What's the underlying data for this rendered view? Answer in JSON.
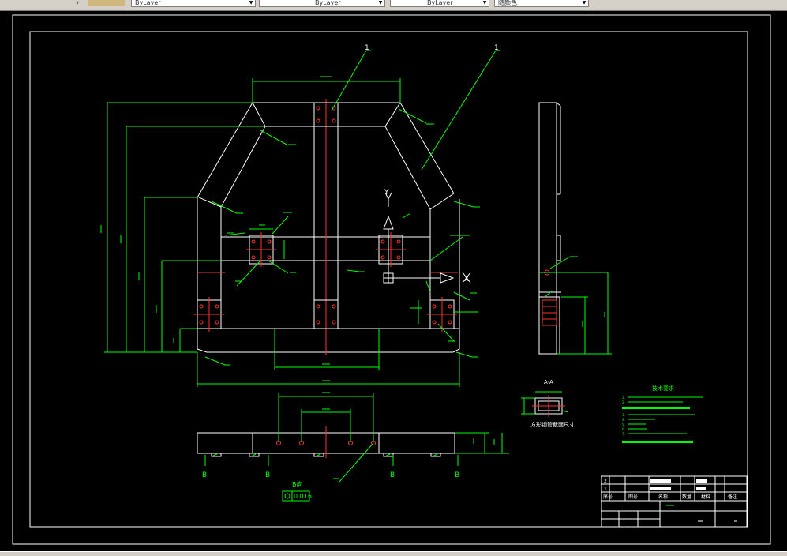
{
  "toolbar": {
    "linetype": "ByLayer",
    "lineweight": "ByLayer",
    "plotstyle": "ByLayer",
    "color_field": "随颜色"
  },
  "drawing": {
    "balloons": [
      "1",
      "1"
    ],
    "axis_y": "Y",
    "axis_x": "X",
    "section_label": "A-A",
    "section_caption": "方形钢管截面尺寸",
    "view_b_label": "B向",
    "b_markers": [
      "B",
      "B",
      "B",
      "B"
    ],
    "tolerance": "0.016",
    "tech_title": "技术要求",
    "tech_notes": [
      "1.",
      "2.",
      "3.",
      "4.",
      "5.",
      "6.",
      "7."
    ]
  },
  "title_block": {
    "item_rows": [
      "2",
      "1"
    ],
    "headers": [
      "序号",
      "图号",
      "名称",
      "数量",
      "材料",
      "备注"
    ]
  },
  "colors": {
    "background": "#000000",
    "geometry": "#ffffff",
    "dimension": "#00ff00",
    "centerline": "#ff3030"
  }
}
